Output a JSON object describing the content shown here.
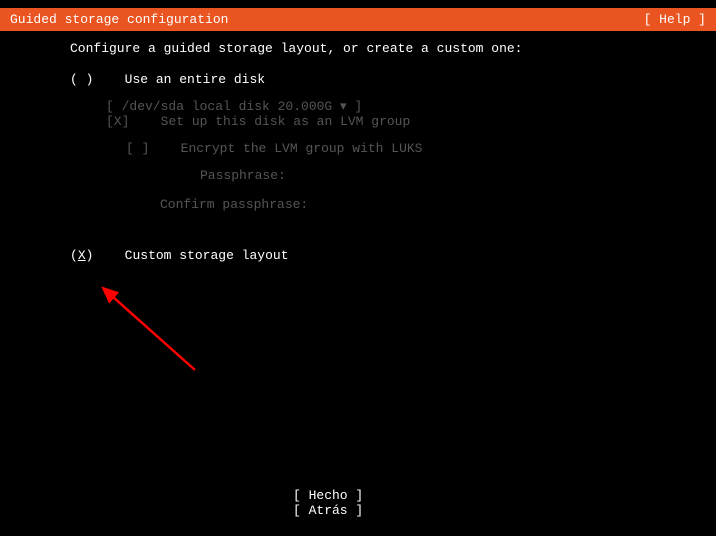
{
  "header": {
    "title": "Guided storage configuration",
    "help": "[ Help ]"
  },
  "main": {
    "instruction": "Configure a guided storage layout, or create a custom one:",
    "option_entire_disk": {
      "radio": "( )",
      "label": "Use an entire disk"
    },
    "disk_selector": "[ /dev/sda local disk  20.000G ▾ ]",
    "lvm": {
      "checkbox": "[X]",
      "label": "Set up this disk as an LVM group"
    },
    "encrypt": {
      "checkbox": "[ ]",
      "label": "Encrypt the LVM group with LUKS"
    },
    "passphrase_label": "Passphrase:",
    "confirm_passphrase_label": "Confirm passphrase:",
    "option_custom": {
      "radio_open": "(",
      "radio_x": "X",
      "radio_close": ")",
      "label": "Custom storage layout"
    }
  },
  "footer": {
    "done": "[ Hecho     ]",
    "back": "[ Atrás     ]"
  }
}
